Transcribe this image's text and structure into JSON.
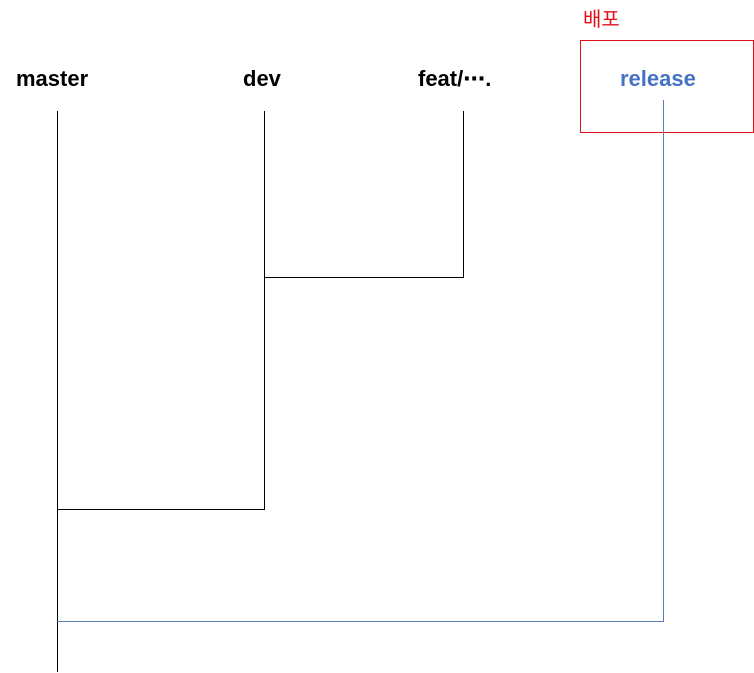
{
  "branches": {
    "master": "master",
    "dev": "dev",
    "feature": "feat/⋯.",
    "release": "release"
  },
  "deploy": {
    "label": "배포"
  },
  "colors": {
    "release": "#4472c4",
    "release_line": "#5b7fb5",
    "deploy": "#e0101a",
    "line": "#000000"
  }
}
